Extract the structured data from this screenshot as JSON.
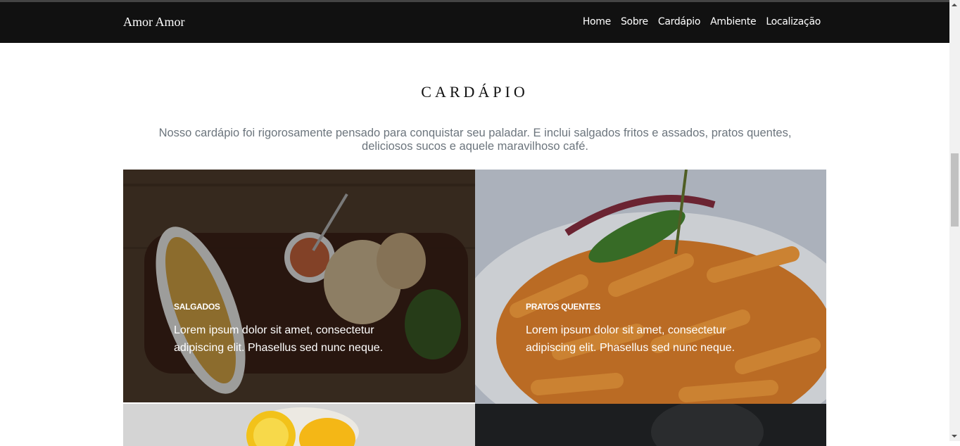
{
  "navbar": {
    "brand": "Amor Amor",
    "links": [
      "Home",
      "Sobre",
      "Cardápio",
      "Ambiente",
      "Localização"
    ]
  },
  "menu_section": {
    "title": "CARDÁPIO",
    "description": "Nosso cardápio foi rigorosamente pensado para conquistar seu paladar. E inclui salgados fritos e assados, pratos quentes, deliciosos sucos e aquele maravilhoso café.",
    "items": [
      {
        "title": "SALGADOS",
        "text": "Lorem ipsum dolor sit amet, consectetur adipiscing elit. Phasellus sed nunc neque."
      },
      {
        "title": "PRATOS QUENTES",
        "text": "Lorem ipsum dolor sit amet, consectetur adipiscing elit. Phasellus sed nunc neque."
      }
    ]
  },
  "colors": {
    "navbar_bg": "#111111",
    "description_text": "#6c757d"
  }
}
